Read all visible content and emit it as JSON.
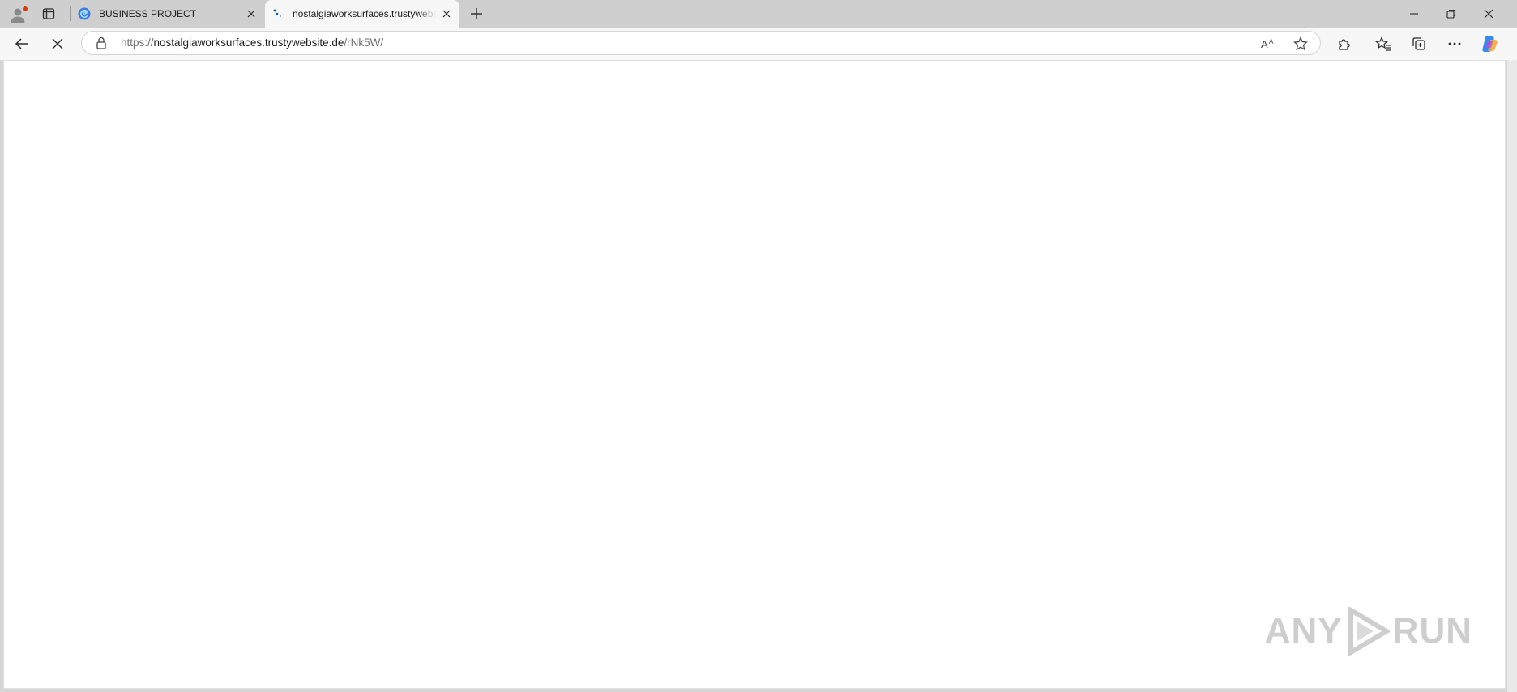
{
  "tabs": [
    {
      "title": "BUSINESS PROJECT",
      "active": false
    },
    {
      "title": "nostalgiaworksurfaces.trustywebsite.de",
      "active": true
    }
  ],
  "address_bar": {
    "protocol": "https://",
    "host": "nostalgiaworksurfaces.trustywebsite.de",
    "path": "/rNk5W/"
  },
  "watermark": {
    "left": "ANY",
    "right": "RUN"
  },
  "icons": {
    "profile": "profile-icon",
    "tab_actions": "tab-actions-icon",
    "new_tab": "plus-icon",
    "minimize": "minimize-icon",
    "restore": "restore-icon",
    "close": "close-icon",
    "back": "back-arrow-icon",
    "stop": "stop-loading-icon",
    "lock": "lock-icon",
    "read_aloud": "read-aloud-icon",
    "favorite": "star-icon",
    "extensions": "puzzle-icon",
    "favorites": "favorites-icon",
    "collections": "collections-icon",
    "more": "more-icon",
    "copilot": "copilot-icon"
  },
  "colors": {
    "tabbar": "#cfcfcf",
    "toolbar": "#f7f7f7",
    "notification_dot": "#d83b01"
  }
}
